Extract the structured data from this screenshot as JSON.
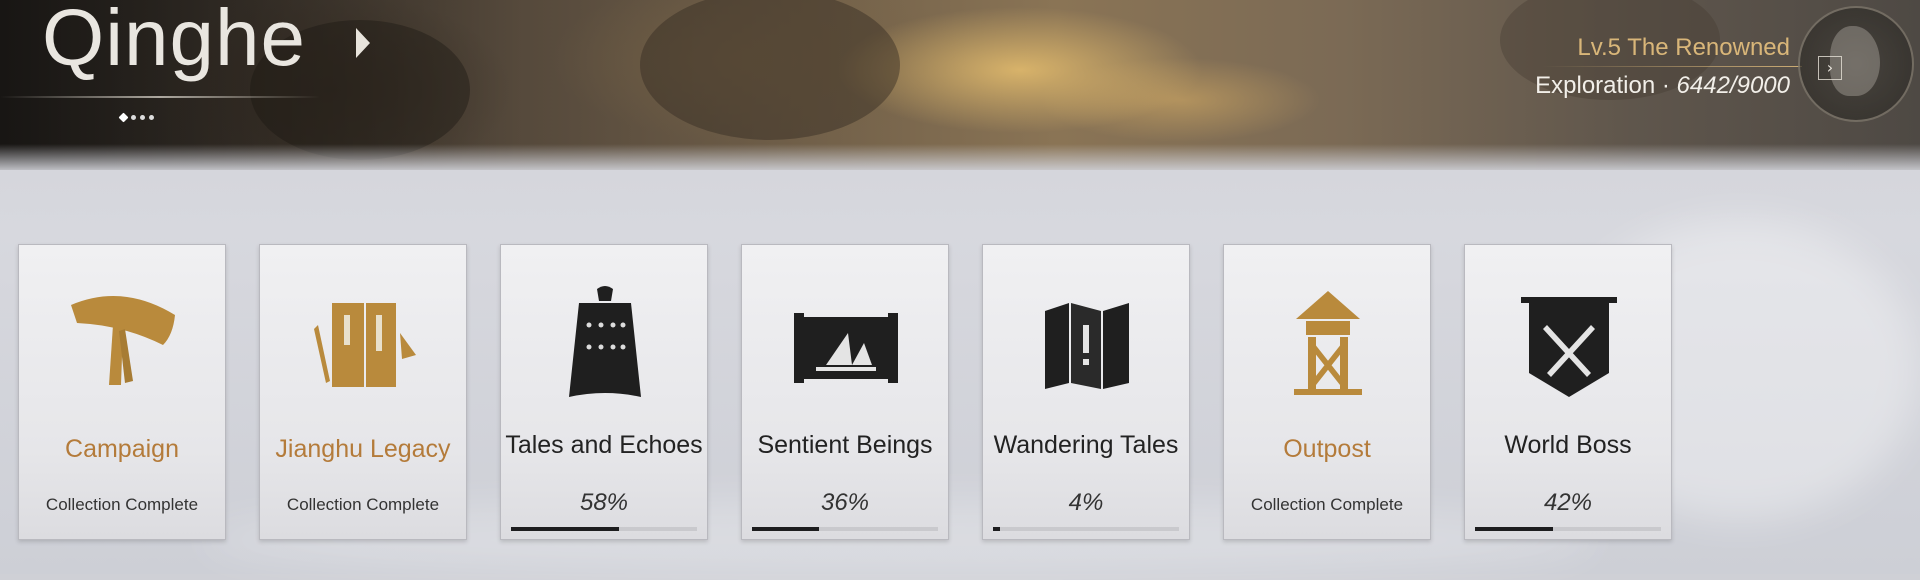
{
  "header": {
    "region_title": "Qinghe",
    "level_text": "Lv.5 The Renowned",
    "exploration_label": "Exploration · ",
    "exploration_value": "6442/9000",
    "pager": {
      "total": 4,
      "active": 0
    }
  },
  "colors": {
    "gold": "#b47b3a",
    "level_gold": "#d9b679",
    "progress_fill": "#1d1d1f"
  },
  "cards": [
    {
      "name": "Campaign",
      "status": "Collection Complete",
      "complete": true,
      "icon": "straw-hat-icon",
      "color": "gold"
    },
    {
      "name": "Jianghu Legacy",
      "status": "Collection Complete",
      "complete": true,
      "icon": "book-icon",
      "color": "gold"
    },
    {
      "name": "Tales and Echoes",
      "percent": "58%",
      "progress": 0.58,
      "complete": false,
      "icon": "bell-icon"
    },
    {
      "name": "Sentient Beings",
      "percent": "36%",
      "progress": 0.36,
      "complete": false,
      "icon": "scroll-painting-icon"
    },
    {
      "name": "Wandering Tales",
      "percent": "4%",
      "progress": 0.04,
      "complete": false,
      "icon": "folded-map-icon"
    },
    {
      "name": "Outpost",
      "status": "Collection Complete",
      "complete": true,
      "icon": "watchtower-icon",
      "color": "gold"
    },
    {
      "name": "World Boss",
      "percent": "42%",
      "progress": 0.42,
      "complete": false,
      "icon": "crossed-swords-banner-icon"
    }
  ]
}
